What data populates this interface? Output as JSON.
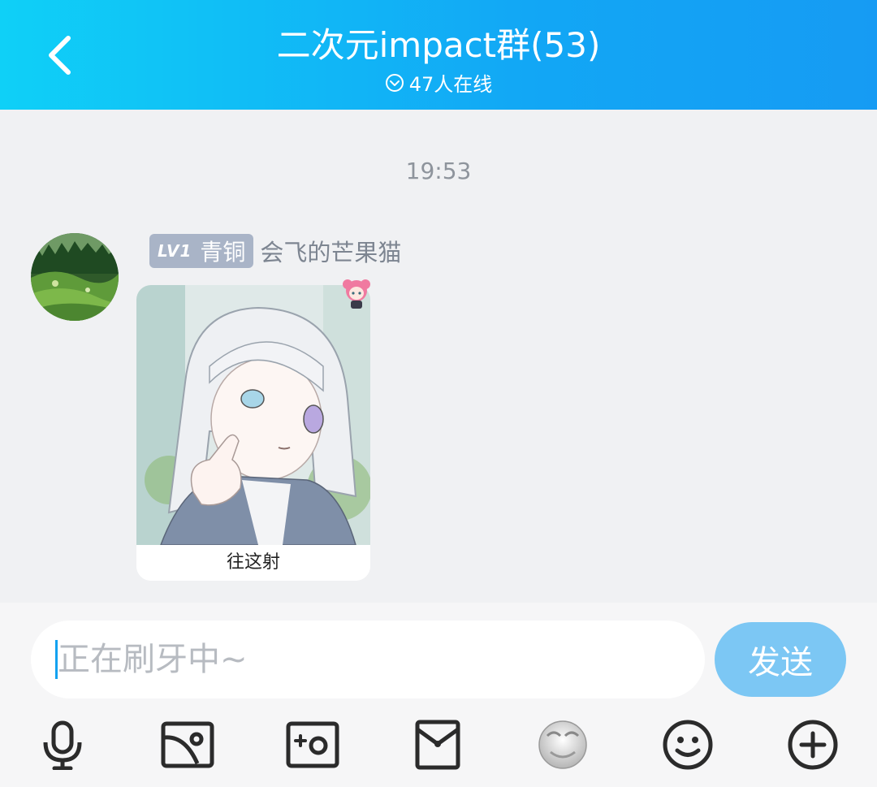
{
  "header": {
    "title": "二次元impact群(53)",
    "online_status": "47人在线",
    "online_icon": "chevron-circle-icon",
    "back_icon": "back-arrow-icon"
  },
  "chat": {
    "timestamp": "19:53",
    "messages": [
      {
        "level": "LV1",
        "rank": "青铜",
        "sender": "会飞的芒果猫",
        "sticker_caption": "往这射"
      }
    ]
  },
  "composer": {
    "placeholder": "正在刷牙中~",
    "send_label": "发送"
  },
  "toolbar": {
    "items": [
      "microphone-icon",
      "gallery-icon",
      "camera-icon",
      "red-packet-icon",
      "cartoon-face-icon",
      "emoji-icon",
      "plus-icon"
    ]
  },
  "colors": {
    "header_start": "#0fd0f7",
    "header_end": "#169bf3",
    "send_button": "#7cc7f4",
    "badge": "#a9b4c7"
  }
}
